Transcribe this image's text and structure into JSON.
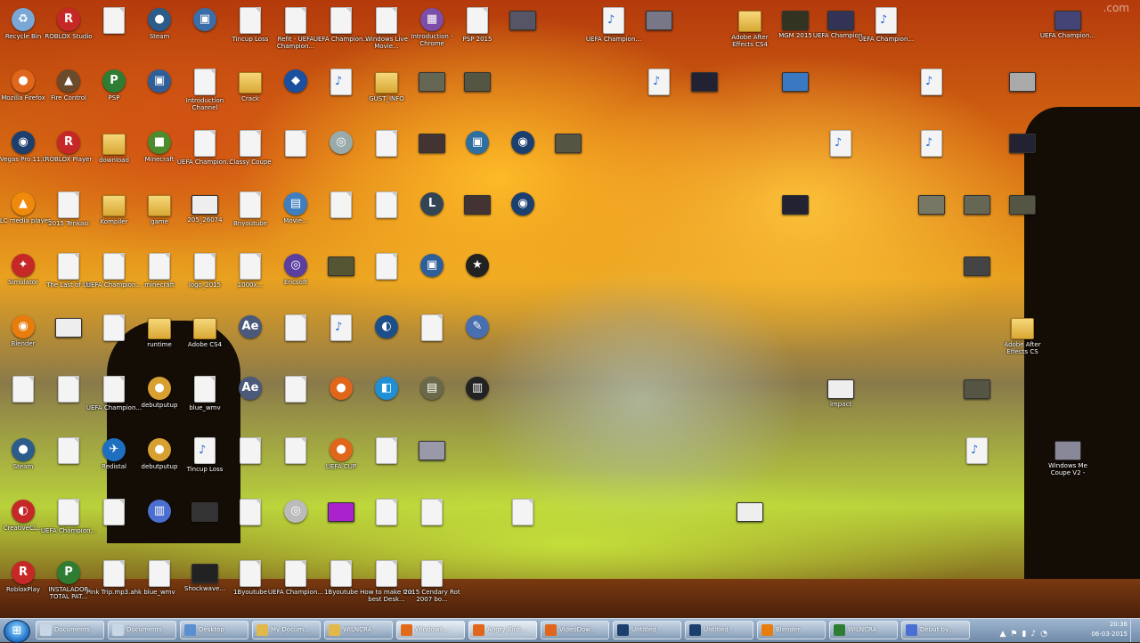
{
  "desktop": {
    "watermark": ".com",
    "icons": [
      {
        "label": "Recycle Bin",
        "kind": "app",
        "color": "#7aa7d6",
        "text": "♻",
        "col": 0,
        "row": 0
      },
      {
        "label": "ROBLOX Studio",
        "kind": "app",
        "color": "#c62828",
        "text": "R",
        "col": 1,
        "row": 0
      },
      {
        "label": "",
        "kind": "doc",
        "col": 2,
        "row": 0
      },
      {
        "label": "Steam",
        "kind": "app",
        "color": "#2b5c8a",
        "text": "●",
        "col": 3,
        "row": 0
      },
      {
        "label": "",
        "kind": "app",
        "color": "#3b6ea8",
        "text": "▣",
        "col": 4,
        "row": 0
      },
      {
        "label": "Tincup Loss",
        "kind": "doc",
        "col": 5,
        "row": 0
      },
      {
        "label": "Refit - UEFA Champion...",
        "kind": "doc",
        "col": 6,
        "row": 0
      },
      {
        "label": "UEFA Champion...",
        "kind": "doc",
        "col": 7,
        "row": 0
      },
      {
        "label": "Windows Live Movie...",
        "kind": "doc",
        "col": 8,
        "row": 0
      },
      {
        "label": "Introduction - Chrome",
        "kind": "app",
        "color": "#7c4ea8",
        "text": "▦",
        "col": 9,
        "row": 0
      },
      {
        "label": "PSP 2015",
        "kind": "doc",
        "col": 10,
        "row": 0
      },
      {
        "label": "",
        "kind": "thumb",
        "color": "#556",
        "col": 11,
        "row": 0
      },
      {
        "label": "UEFA Champion...",
        "kind": "media",
        "col": 13,
        "row": 0
      },
      {
        "label": "",
        "kind": "thumb",
        "color": "#778",
        "col": 14,
        "row": 0
      },
      {
        "label": "Adobe After Effects CS4",
        "kind": "folder",
        "col": 16,
        "row": 0
      },
      {
        "label": "MGM 2015",
        "kind": "thumb",
        "color": "#332",
        "col": 17,
        "row": 0
      },
      {
        "label": "UEFA Champion...",
        "kind": "thumb",
        "color": "#335",
        "col": 18,
        "row": 0
      },
      {
        "label": "UEFA Champion...",
        "kind": "media",
        "col": 19,
        "row": 0
      },
      {
        "label": "UEFA Champion...",
        "kind": "thumb",
        "color": "#447",
        "col": 23,
        "row": 0
      },
      {
        "label": "Mozilla Firefox",
        "kind": "app",
        "color": "#e0661b",
        "text": "●",
        "col": 0,
        "row": 1
      },
      {
        "label": "Fire Control",
        "kind": "app",
        "color": "#6b4b2b",
        "text": "▲",
        "col": 1,
        "row": 1
      },
      {
        "label": "PSP",
        "kind": "app",
        "color": "#2e7d32",
        "text": "P",
        "col": 2,
        "row": 1
      },
      {
        "label": "",
        "kind": "app",
        "color": "#2f5f99",
        "text": "▣",
        "col": 3,
        "row": 1
      },
      {
        "label": "Introduction Channel",
        "kind": "doc",
        "col": 4,
        "row": 1
      },
      {
        "label": "Crack",
        "kind": "folder",
        "col": 5,
        "row": 1
      },
      {
        "label": "",
        "kind": "app",
        "color": "#1b4fa0",
        "text": "◆",
        "col": 6,
        "row": 1
      },
      {
        "label": "",
        "kind": "media",
        "col": 7,
        "row": 1
      },
      {
        "label": "GUST_INFO",
        "kind": "folder",
        "col": 8,
        "row": 1
      },
      {
        "label": "",
        "kind": "thumb",
        "color": "#665",
        "col": 9,
        "row": 1
      },
      {
        "label": "",
        "kind": "thumb",
        "color": "#554",
        "col": 10,
        "row": 1
      },
      {
        "label": "",
        "kind": "media",
        "col": 14,
        "row": 1
      },
      {
        "label": "",
        "kind": "thumb",
        "color": "#223",
        "col": 15,
        "row": 1
      },
      {
        "label": "",
        "kind": "thumb",
        "color": "#3a78c2",
        "col": 17,
        "row": 1
      },
      {
        "label": "",
        "kind": "media",
        "col": 20,
        "row": 1
      },
      {
        "label": "",
        "kind": "thumb",
        "color": "#aaa",
        "col": 22,
        "row": 1
      },
      {
        "label": "Vegas Pro 11.0",
        "kind": "app",
        "color": "#1c3f6e",
        "text": "◉",
        "col": 0,
        "row": 2
      },
      {
        "label": "ROBLOX Player",
        "kind": "app",
        "color": "#c62828",
        "text": "R",
        "col": 1,
        "row": 2
      },
      {
        "label": "download",
        "kind": "folder",
        "col": 2,
        "row": 2
      },
      {
        "label": "Minecraft",
        "kind": "app",
        "color": "#4e8a2e",
        "text": "■",
        "col": 3,
        "row": 2
      },
      {
        "label": "UEFA Champion...",
        "kind": "doc",
        "col": 4,
        "row": 2
      },
      {
        "label": "Classy Coupe",
        "kind": "doc",
        "col": 5,
        "row": 2
      },
      {
        "label": "",
        "kind": "doc",
        "col": 6,
        "row": 2
      },
      {
        "label": "",
        "kind": "app",
        "color": "#9aa",
        "text": "◎",
        "col": 7,
        "row": 2
      },
      {
        "label": "",
        "kind": "doc",
        "col": 8,
        "row": 2
      },
      {
        "label": "",
        "kind": "thumb",
        "color": "#433",
        "col": 9,
        "row": 2
      },
      {
        "label": "",
        "kind": "app",
        "color": "#2f6ea0",
        "text": "▣",
        "col": 10,
        "row": 2
      },
      {
        "label": "",
        "kind": "app",
        "color": "#1b3f6e",
        "text": "◉",
        "col": 11,
        "row": 2
      },
      {
        "label": "",
        "kind": "thumb",
        "color": "#554",
        "col": 12,
        "row": 2
      },
      {
        "label": "",
        "kind": "media",
        "col": 18,
        "row": 2
      },
      {
        "label": "",
        "kind": "media",
        "col": 20,
        "row": 2
      },
      {
        "label": "",
        "kind": "thumb",
        "color": "#223",
        "col": 22,
        "row": 2
      },
      {
        "label": "VLC media player",
        "kind": "app",
        "color": "#f08a0c",
        "text": "▲",
        "col": 0,
        "row": 3
      },
      {
        "label": "2015 Tenkasi",
        "kind": "doc",
        "col": 1,
        "row": 3
      },
      {
        "label": "Kompiler",
        "kind": "folder",
        "col": 2,
        "row": 3
      },
      {
        "label": "game",
        "kind": "folder",
        "col": 3,
        "row": 3
      },
      {
        "label": "205_26074",
        "kind": "thumb",
        "color": "#eee",
        "col": 4,
        "row": 3
      },
      {
        "label": "Bnyoutube",
        "kind": "doc",
        "col": 5,
        "row": 3
      },
      {
        "label": "Movie...",
        "kind": "app",
        "color": "#3f7fbf",
        "text": "▤",
        "col": 6,
        "row": 3
      },
      {
        "label": "",
        "kind": "doc",
        "col": 7,
        "row": 3
      },
      {
        "label": "",
        "kind": "doc",
        "col": 8,
        "row": 3
      },
      {
        "label": "",
        "kind": "app",
        "color": "#345",
        "text": "L",
        "col": 9,
        "row": 3
      },
      {
        "label": "",
        "kind": "thumb",
        "color": "#433",
        "col": 10,
        "row": 3
      },
      {
        "label": "",
        "kind": "app",
        "color": "#1b3f6e",
        "text": "◉",
        "col": 11,
        "row": 3
      },
      {
        "label": "",
        "kind": "thumb",
        "color": "#223",
        "col": 17,
        "row": 3
      },
      {
        "label": "",
        "kind": "thumb",
        "color": "#776",
        "col": 20,
        "row": 3
      },
      {
        "label": "",
        "kind": "thumb",
        "color": "#665",
        "col": 21,
        "row": 3
      },
      {
        "label": "",
        "kind": "thumb",
        "color": "#554",
        "col": 22,
        "row": 3
      },
      {
        "label": "Simulator",
        "kind": "app",
        "color": "#c62828",
        "text": "✦",
        "col": 0,
        "row": 4
      },
      {
        "label": "The Last of Us",
        "kind": "doc",
        "col": 1,
        "row": 4
      },
      {
        "label": "UEFA Champion...",
        "kind": "doc",
        "col": 2,
        "row": 4
      },
      {
        "label": "minecraft",
        "kind": "doc",
        "col": 3,
        "row": 4
      },
      {
        "label": "logo_2015",
        "kind": "doc",
        "col": 4,
        "row": 4
      },
      {
        "label": "1000x...",
        "kind": "doc",
        "col": 5,
        "row": 4
      },
      {
        "label": "Ericsoft",
        "kind": "app",
        "color": "#5a3fa0",
        "text": "◎",
        "col": 6,
        "row": 4
      },
      {
        "label": "",
        "kind": "thumb",
        "color": "#553",
        "col": 7,
        "row": 4
      },
      {
        "label": "",
        "kind": "doc",
        "col": 8,
        "row": 4
      },
      {
        "label": "",
        "kind": "app",
        "color": "#2f5f99",
        "text": "▣",
        "col": 9,
        "row": 4
      },
      {
        "label": "",
        "kind": "app",
        "color": "#222",
        "text": "★",
        "col": 10,
        "row": 4
      },
      {
        "label": "",
        "kind": "thumb",
        "color": "#444",
        "col": 21,
        "row": 4
      },
      {
        "label": "Blender",
        "kind": "app",
        "color": "#e87d0d",
        "text": "◉",
        "col": 0,
        "row": 5
      },
      {
        "label": "",
        "kind": "thumb",
        "color": "#eee",
        "col": 1,
        "row": 5
      },
      {
        "label": "",
        "kind": "doc",
        "col": 2,
        "row": 5
      },
      {
        "label": "runtime",
        "kind": "folder",
        "col": 3,
        "row": 5
      },
      {
        "label": "Adobe CS4",
        "kind": "folder",
        "col": 4,
        "row": 5
      },
      {
        "label": "",
        "kind": "app",
        "color": "#4b5a7a",
        "text": "Ae",
        "col": 5,
        "row": 5
      },
      {
        "label": "",
        "kind": "doc",
        "col": 6,
        "row": 5
      },
      {
        "label": "",
        "kind": "media",
        "col": 7,
        "row": 5
      },
      {
        "label": "",
        "kind": "app",
        "color": "#1c4f8a",
        "text": "◐",
        "col": 8,
        "row": 5
      },
      {
        "label": "",
        "kind": "doc",
        "col": 9,
        "row": 5
      },
      {
        "label": "",
        "kind": "app",
        "color": "#4a6fb0",
        "text": "✎",
        "col": 10,
        "row": 5
      },
      {
        "label": "Adobe After Effects CS",
        "kind": "folder",
        "col": 22,
        "row": 5
      },
      {
        "label": "",
        "kind": "doc",
        "col": 0,
        "row": 6
      },
      {
        "label": "",
        "kind": "doc",
        "col": 1,
        "row": 6
      },
      {
        "label": "UEFA Champion...",
        "kind": "doc",
        "col": 2,
        "row": 6
      },
      {
        "label": "debutputup",
        "kind": "app",
        "color": "#d8a030",
        "text": "●",
        "col": 3,
        "row": 6
      },
      {
        "label": "blue_wmv",
        "kind": "doc",
        "col": 4,
        "row": 6
      },
      {
        "label": "",
        "kind": "app",
        "color": "#4b5a7a",
        "text": "Ae",
        "col": 5,
        "row": 6
      },
      {
        "label": "",
        "kind": "doc",
        "col": 6,
        "row": 6
      },
      {
        "label": "",
        "kind": "app",
        "color": "#e0661b",
        "text": "●",
        "col": 7,
        "row": 6
      },
      {
        "label": "",
        "kind": "app",
        "color": "#1f8fd6",
        "text": "◧",
        "col": 8,
        "row": 6
      },
      {
        "label": "",
        "kind": "app",
        "color": "#6a6a4a",
        "text": "▤",
        "col": 9,
        "row": 6
      },
      {
        "label": "",
        "kind": "app",
        "color": "#222",
        "text": "▥",
        "col": 10,
        "row": 6
      },
      {
        "label": "impact",
        "kind": "thumb",
        "color": "#eee",
        "col": 18,
        "row": 6
      },
      {
        "label": "",
        "kind": "thumb",
        "color": "#554",
        "col": 21,
        "row": 6
      },
      {
        "label": "Steam",
        "kind": "app",
        "color": "#2b5c8a",
        "text": "●",
        "col": 0,
        "row": 7
      },
      {
        "label": "",
        "kind": "doc",
        "col": 1,
        "row": 7
      },
      {
        "label": "Redistal",
        "kind": "app",
        "color": "#1f6fc0",
        "text": "✈",
        "col": 2,
        "row": 7
      },
      {
        "label": "debutputup",
        "kind": "app",
        "color": "#d8a030",
        "text": "●",
        "col": 3,
        "row": 7
      },
      {
        "label": "Tincup Loss",
        "kind": "media",
        "col": 4,
        "row": 7
      },
      {
        "label": "",
        "kind": "doc",
        "col": 5,
        "row": 7
      },
      {
        "label": "",
        "kind": "doc",
        "col": 6,
        "row": 7
      },
      {
        "label": "UEFA CUP",
        "kind": "app",
        "color": "#e0661b",
        "text": "●",
        "col": 7,
        "row": 7
      },
      {
        "label": "",
        "kind": "doc",
        "col": 8,
        "row": 7
      },
      {
        "label": "",
        "kind": "thumb",
        "color": "#99a",
        "col": 9,
        "row": 7
      },
      {
        "label": "",
        "kind": "media",
        "col": 21,
        "row": 7
      },
      {
        "label": "Windows Me Coupe V2 -",
        "kind": "thumb",
        "color": "#889",
        "col": 23,
        "row": 7
      },
      {
        "label": "CreativeCL...",
        "kind": "app",
        "color": "#c62828",
        "text": "◐",
        "col": 0,
        "row": 8
      },
      {
        "label": "UEFA Champion...",
        "kind": "doc",
        "col": 1,
        "row": 8
      },
      {
        "label": "",
        "kind": "doc",
        "col": 2,
        "row": 8
      },
      {
        "label": "",
        "kind": "app",
        "color": "#4a6fd0",
        "text": "▥",
        "col": 3,
        "row": 8
      },
      {
        "label": "",
        "kind": "thumb",
        "color": "#333",
        "col": 4,
        "row": 8
      },
      {
        "label": "",
        "kind": "doc",
        "col": 5,
        "row": 8
      },
      {
        "label": "",
        "kind": "app",
        "color": "#bbb",
        "text": "◎",
        "col": 6,
        "row": 8
      },
      {
        "label": "",
        "kind": "thumb",
        "color": "#a2c",
        "col": 7,
        "row": 8
      },
      {
        "label": "",
        "kind": "doc",
        "col": 8,
        "row": 8
      },
      {
        "label": "",
        "kind": "doc",
        "col": 9,
        "row": 8
      },
      {
        "label": "",
        "kind": "doc",
        "col": 11,
        "row": 8
      },
      {
        "label": "",
        "kind": "thumb",
        "color": "#eee",
        "col": 16,
        "row": 8
      },
      {
        "label": "RobloxPlay",
        "kind": "app",
        "color": "#c62828",
        "text": "R",
        "col": 0,
        "row": 9
      },
      {
        "label": "INSTALADOR TOTAL PAT...",
        "kind": "app",
        "color": "#2e7d32",
        "text": "P",
        "col": 1,
        "row": 9
      },
      {
        "label": "Pink Trip.mp3.ahk",
        "kind": "doc",
        "col": 2,
        "row": 9
      },
      {
        "label": "blue_wmv",
        "kind": "doc",
        "col": 3,
        "row": 9
      },
      {
        "label": "Shockwave...",
        "kind": "thumb",
        "color": "#222",
        "col": 4,
        "row": 9
      },
      {
        "label": "1Byoutube",
        "kind": "doc",
        "col": 5,
        "row": 9
      },
      {
        "label": "UEFA Champion...",
        "kind": "doc",
        "col": 6,
        "row": 9
      },
      {
        "label": "1Byoutube",
        "kind": "doc",
        "col": 7,
        "row": 9
      },
      {
        "label": "How to make the best Desk...",
        "kind": "doc",
        "col": 8,
        "row": 9
      },
      {
        "label": "2015 Cendary Rot 2007 bo...",
        "kind": "doc",
        "col": 9,
        "row": 9
      }
    ]
  },
  "taskbar": {
    "start_label": "⊞",
    "tasks": [
      {
        "label": "Documents",
        "color": "#c8d6e6",
        "active": false
      },
      {
        "label": "Documents",
        "color": "#c8d6e6",
        "active": false
      },
      {
        "label": "Desktop",
        "color": "#5a8fd0",
        "active": false
      },
      {
        "label": "My Docum...",
        "color": "#e3b84a",
        "active": false
      },
      {
        "label": "WILNCRA",
        "color": "#e3b84a",
        "active": false
      },
      {
        "label": "Windows...",
        "color": "#e06a1a",
        "active": true
      },
      {
        "label": "Angry Bird...",
        "color": "#e0661b",
        "active": true
      },
      {
        "label": "VideoDow...",
        "color": "#e0661b",
        "active": false
      },
      {
        "label": "Untitled -",
        "color": "#1c3f6e",
        "active": false
      },
      {
        "label": "Untitled -",
        "color": "#1c3f6e",
        "active": false
      },
      {
        "label": "Blender",
        "color": "#e87d0d",
        "active": false
      },
      {
        "label": "WILNCRA",
        "color": "#2e7d32",
        "active": false
      },
      {
        "label": "Debut by...",
        "color": "#4a6fd0",
        "active": false
      }
    ],
    "tray_icons": [
      "▲",
      "⚑",
      "▮",
      "♪",
      "◔"
    ],
    "clock_time": "20:36",
    "clock_date": "06-03-2015"
  }
}
